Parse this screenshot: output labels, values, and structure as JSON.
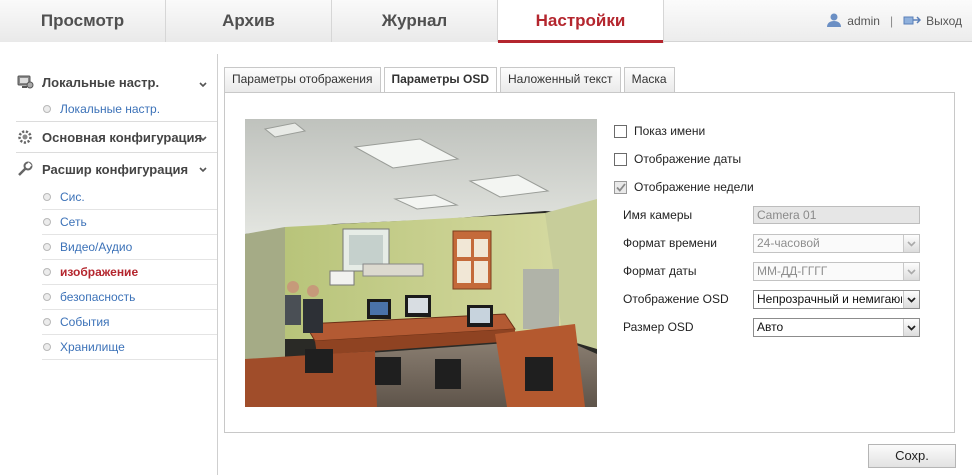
{
  "topnav": {
    "tabs": [
      {
        "label": "Просмотр"
      },
      {
        "label": "Архив"
      },
      {
        "label": "Журнал"
      },
      {
        "label": "Настройки"
      }
    ],
    "user": "admin",
    "separator": "|",
    "logout": "Выход"
  },
  "sidebar": {
    "groups": [
      {
        "label": "Локальные настр.",
        "items": [
          {
            "label": "Локальные настр."
          }
        ]
      },
      {
        "label": "Основная конфигурация"
      },
      {
        "label": "Расшир конфигурация",
        "items": [
          {
            "label": "Сис."
          },
          {
            "label": "Сеть"
          },
          {
            "label": "Видео/Аудио"
          },
          {
            "label": "изображение"
          },
          {
            "label": "безопасность"
          },
          {
            "label": "События"
          },
          {
            "label": "Хранилище"
          }
        ]
      }
    ]
  },
  "content": {
    "tabs": [
      {
        "label": "Параметры отображения"
      },
      {
        "label": "Параметры OSD"
      },
      {
        "label": "Наложенный текст"
      },
      {
        "label": "Маска"
      }
    ]
  },
  "osd": {
    "show_name": {
      "label": "Показ имени",
      "checked": false
    },
    "show_date": {
      "label": "Отображение даты",
      "checked": false
    },
    "show_week": {
      "label": "Отображение недели",
      "checked": true
    },
    "camera_name": {
      "label": "Имя камеры",
      "value": "Camera 01"
    },
    "time_format": {
      "label": "Формат времени",
      "value": "24-часовой"
    },
    "date_format": {
      "label": "Формат даты",
      "value": "ММ-ДД-ГГГГ"
    },
    "osd_display": {
      "label": "Отображение OSD",
      "value": "Непрозрачный и немигающий"
    },
    "osd_size": {
      "label": "Размер OSD",
      "value": "Авто"
    }
  },
  "save_label": "Сохр.",
  "colors": {
    "accent": "#b4262e",
    "link": "#3c72b8"
  }
}
